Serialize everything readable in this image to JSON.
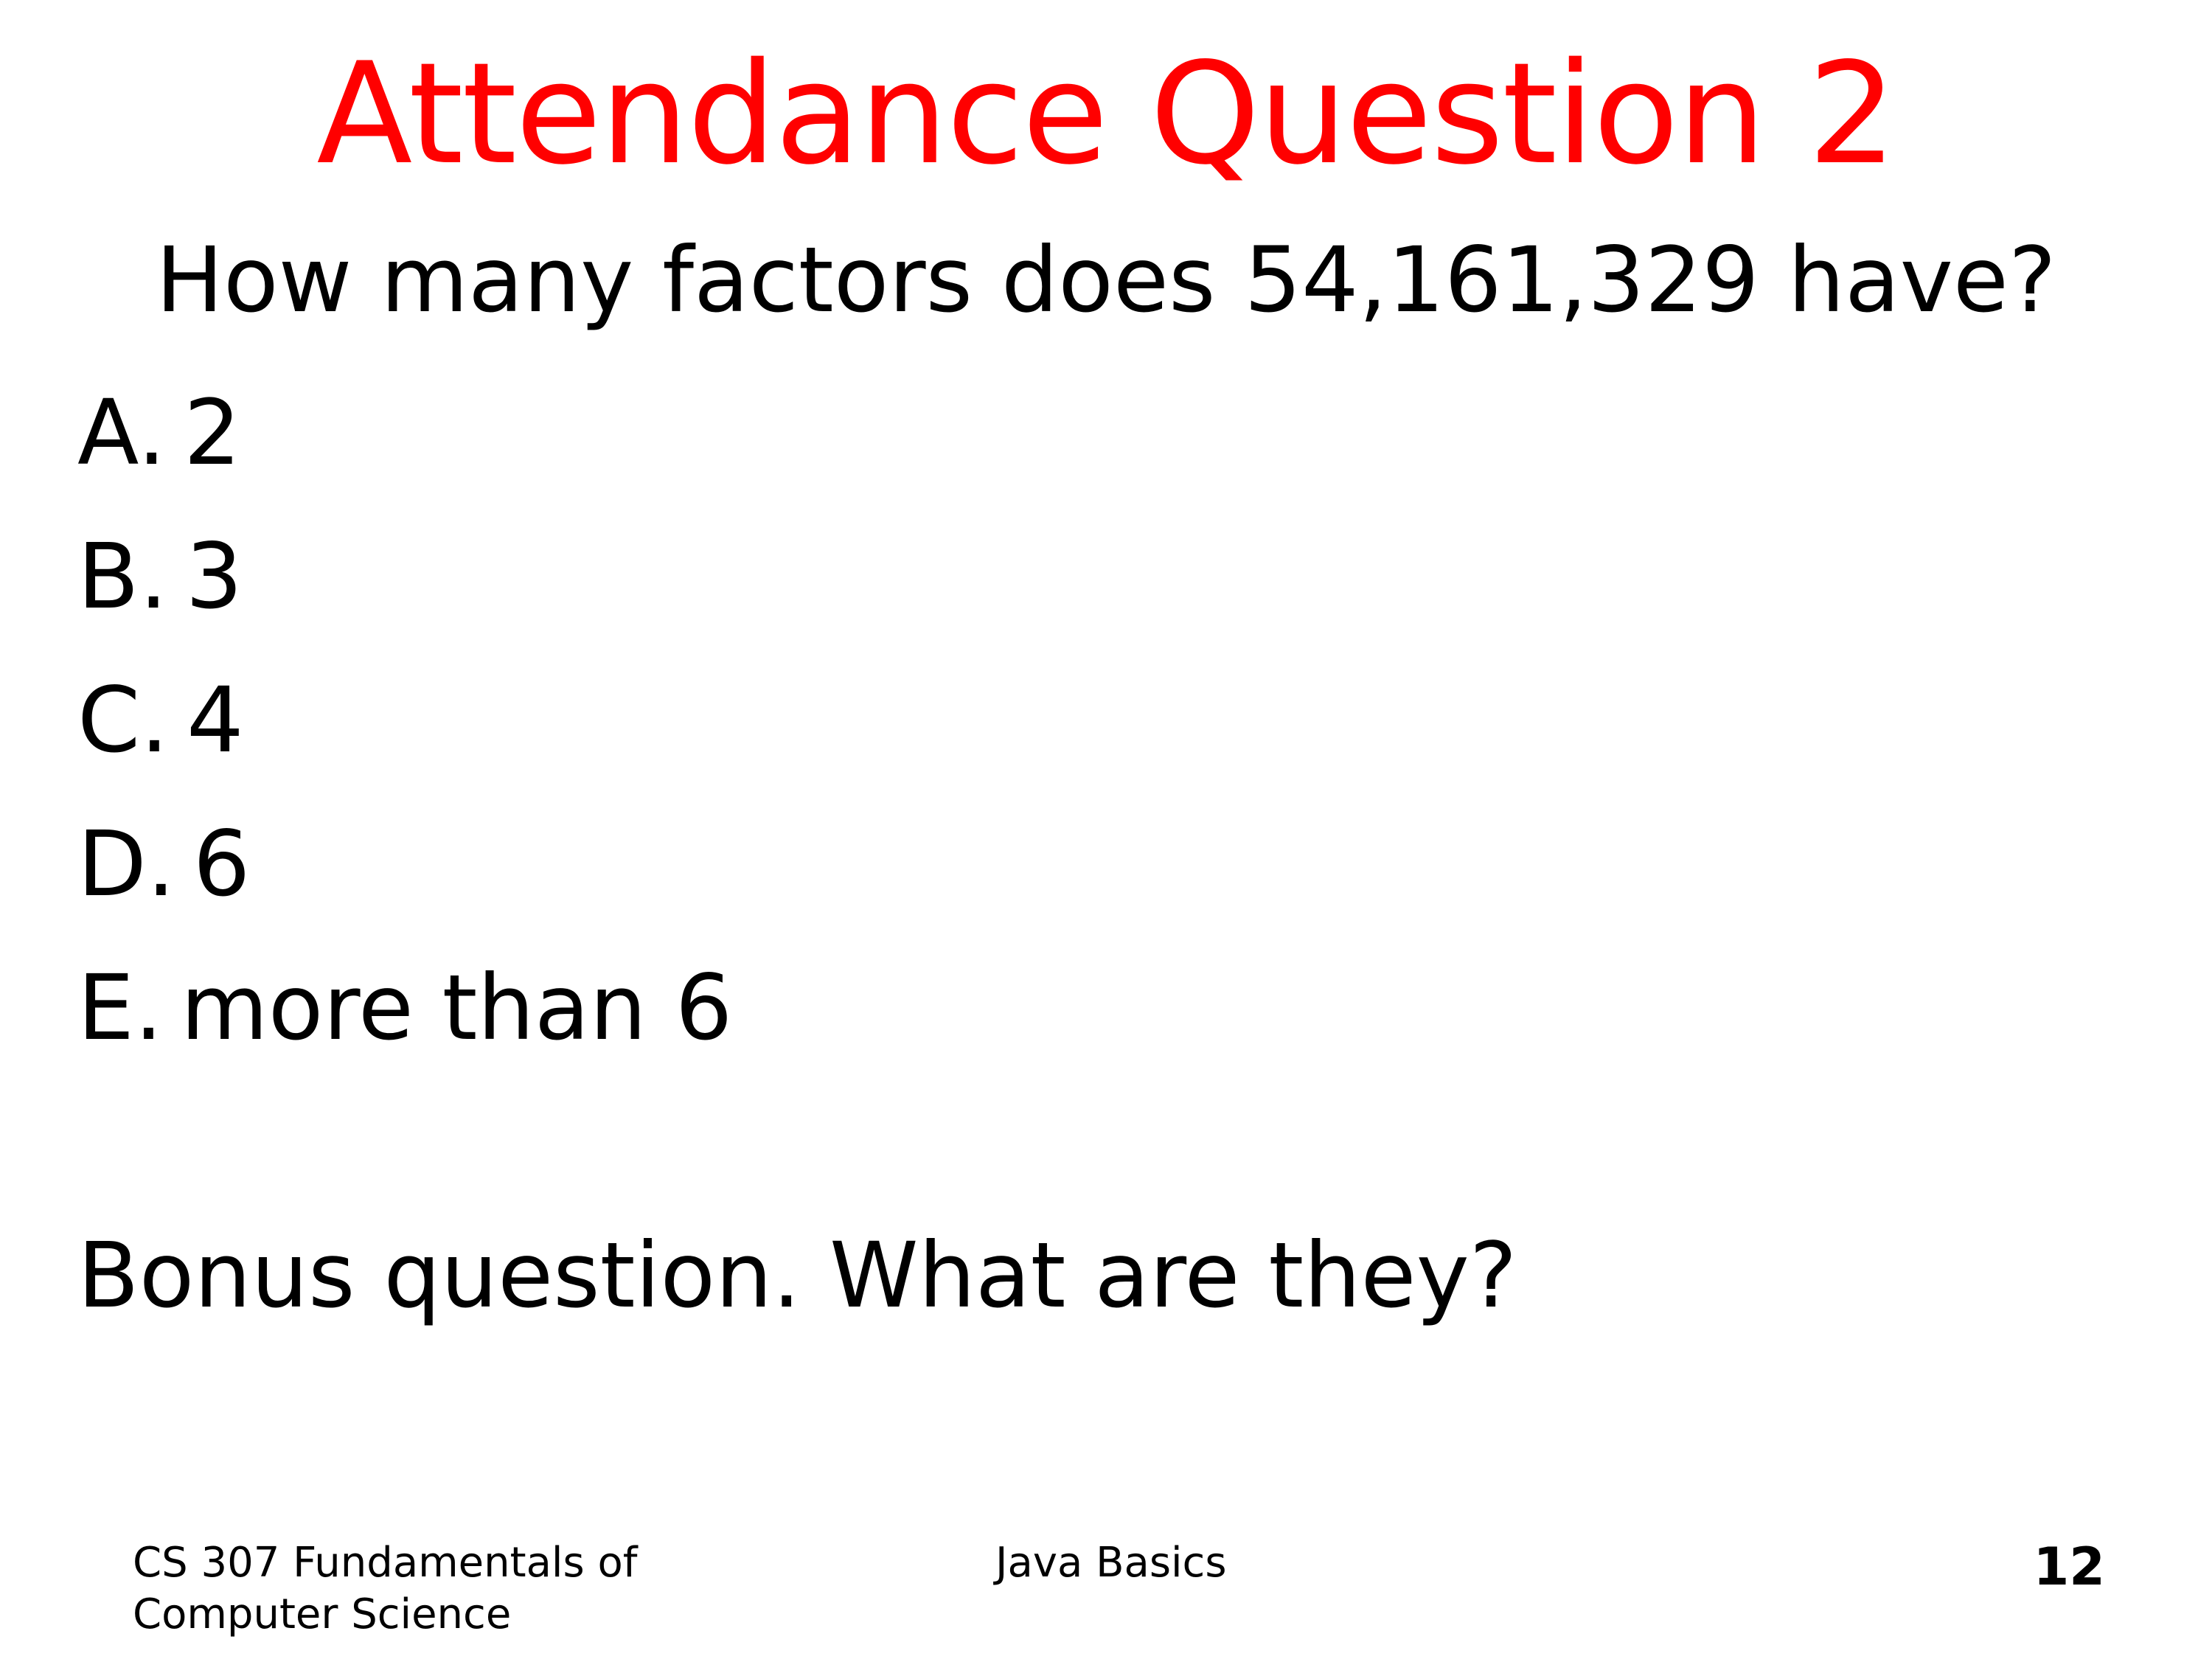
{
  "colors": {
    "title": "#ff0000",
    "text": "#000000",
    "background": "#ffffff"
  },
  "slide": {
    "title": "Attendance Question 2",
    "question": "How many factors does 54,161,329 have?",
    "options": [
      {
        "letter": "A.",
        "text": "2"
      },
      {
        "letter": "B.",
        "text": "3"
      },
      {
        "letter": "C.",
        "text": "4"
      },
      {
        "letter": "D.",
        "text": "6"
      },
      {
        "letter": "E.",
        "text": "more than 6"
      }
    ],
    "bonus": "Bonus question. What are they?"
  },
  "footer": {
    "course_line1": "CS 307 Fundamentals of",
    "course_line2": "Computer Science",
    "topic": "Java Basics",
    "slide_number": "12"
  }
}
